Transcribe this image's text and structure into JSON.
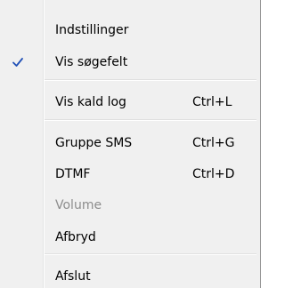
{
  "menu": {
    "items": [
      {
        "label": "Indstillinger",
        "shortcut": "",
        "checked": false,
        "disabled": false
      },
      {
        "label": "Vis søgefelt",
        "shortcut": "",
        "checked": true,
        "disabled": false
      },
      {
        "label": "Vis kald log",
        "shortcut": "Ctrl+L",
        "checked": false,
        "disabled": false
      },
      {
        "label": "Gruppe SMS",
        "shortcut": "Ctrl+G",
        "checked": false,
        "disabled": false
      },
      {
        "label": "DTMF",
        "shortcut": "Ctrl+D",
        "checked": false,
        "disabled": false
      },
      {
        "label": "Volume",
        "shortcut": "",
        "checked": false,
        "disabled": true
      },
      {
        "label": "Afbryd",
        "shortcut": "",
        "checked": false,
        "disabled": false
      },
      {
        "label": "Afslut",
        "shortcut": "",
        "checked": false,
        "disabled": false
      }
    ]
  },
  "colors": {
    "check": "#1f4fb6",
    "disabled_text": "#8d8d8d",
    "menu_bg": "#f0f0f0"
  },
  "icons": {
    "check": "check-icon"
  }
}
